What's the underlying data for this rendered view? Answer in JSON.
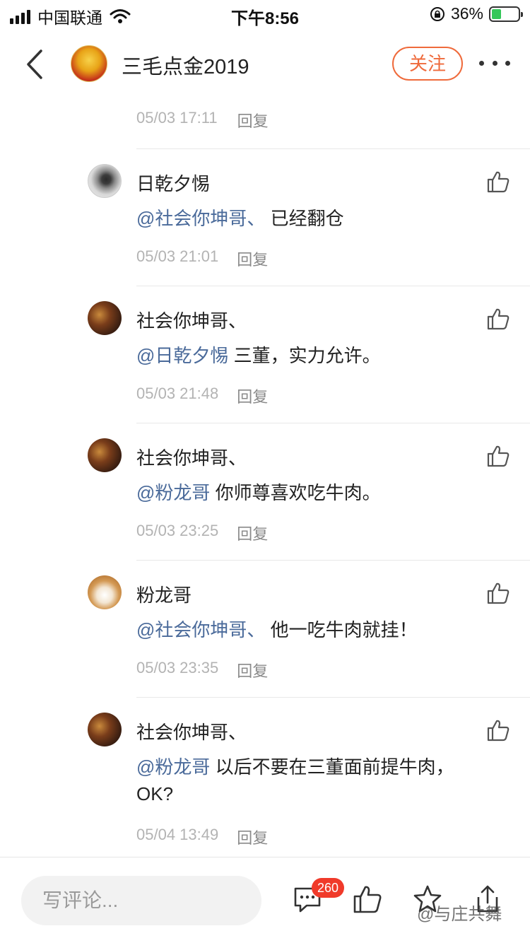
{
  "status_bar": {
    "carrier": "中国联通",
    "time": "下午8:56",
    "battery_percent": "36%",
    "battery_level": 0.36,
    "colors": {
      "battery": "#34c759"
    }
  },
  "header": {
    "title": "三毛点金2019",
    "follow_label": "关注",
    "back_icon": "chevron-left-icon",
    "more_icon": "more-dots-icon"
  },
  "top_meta": {
    "time": "05/03 17:11",
    "reply_label": "回复"
  },
  "comments": [
    {
      "name": "日乾夕惕",
      "mention": "@社会你坤哥、",
      "text": " 已经翻仓",
      "time": "05/03 21:01",
      "reply_label": "回复",
      "avatar": "ink-avatar"
    },
    {
      "name": "社会你坤哥、",
      "mention": "@日乾夕惕",
      "text": " 三董，实力允许。",
      "time": "05/03 21:48",
      "reply_label": "回复",
      "avatar": "shop-avatar"
    },
    {
      "name": "社会你坤哥、",
      "mention": "@粉龙哥",
      "text": " 你师尊喜欢吃牛肉。",
      "time": "05/03 23:25",
      "reply_label": "回复",
      "avatar": "shop-avatar"
    },
    {
      "name": "粉龙哥",
      "mention": "@社会你坤哥、",
      "text": " 他一吃牛肉就挂！",
      "time": "05/03 23:35",
      "reply_label": "回复",
      "avatar": "dog-avatar"
    },
    {
      "name": "社会你坤哥、",
      "mention": "@粉龙哥",
      "text": " 以后不要在三董面前提牛肉，OK?",
      "time": "05/04 13:49",
      "reply_label": "回复",
      "avatar": "shop-avatar"
    }
  ],
  "bottom_bar": {
    "placeholder": "写评论...",
    "comment_count": "260",
    "watermark": "@与庄共舞"
  },
  "colors": {
    "accent": "#ef6a3b",
    "mention": "#4a6a9a",
    "badge": "#f03a2a",
    "meta_text": "#b3b3b3"
  }
}
